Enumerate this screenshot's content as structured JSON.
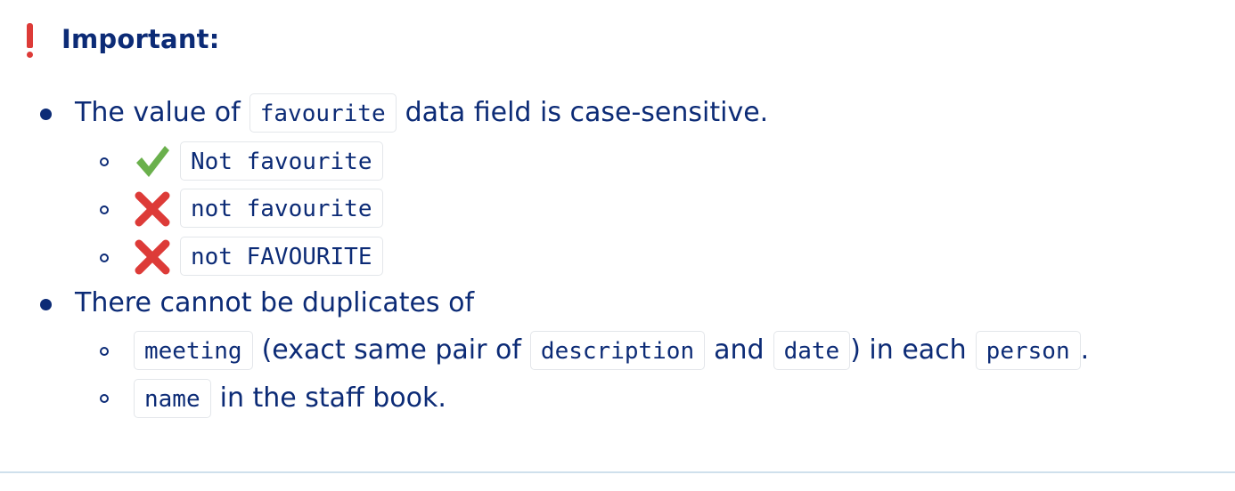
{
  "callout": {
    "title": "Important:",
    "bang_icon": "exclamation-icon",
    "accent_color": "#dd3b38",
    "text_color": "#0c2b76"
  },
  "items": {
    "first": {
      "pre": "The value of",
      "code": "favourite",
      "post": "data field is case-sensitive.",
      "examples": [
        {
          "icon": "check-icon",
          "code": "Not favourite"
        },
        {
          "icon": "cross-icon",
          "code": "not favourite"
        },
        {
          "icon": "cross-icon",
          "code": "not FAVOURITE"
        }
      ]
    },
    "second": {
      "text": "There cannot be duplicates of",
      "sub1": {
        "code1": "meeting",
        "t1": "(exact same pair of",
        "code2": "description",
        "t2": "and",
        "code3": "date",
        "t3": ") in each",
        "code4": "person",
        "t4": "."
      },
      "sub2": {
        "code": "name",
        "text": "in the staff book."
      }
    }
  }
}
